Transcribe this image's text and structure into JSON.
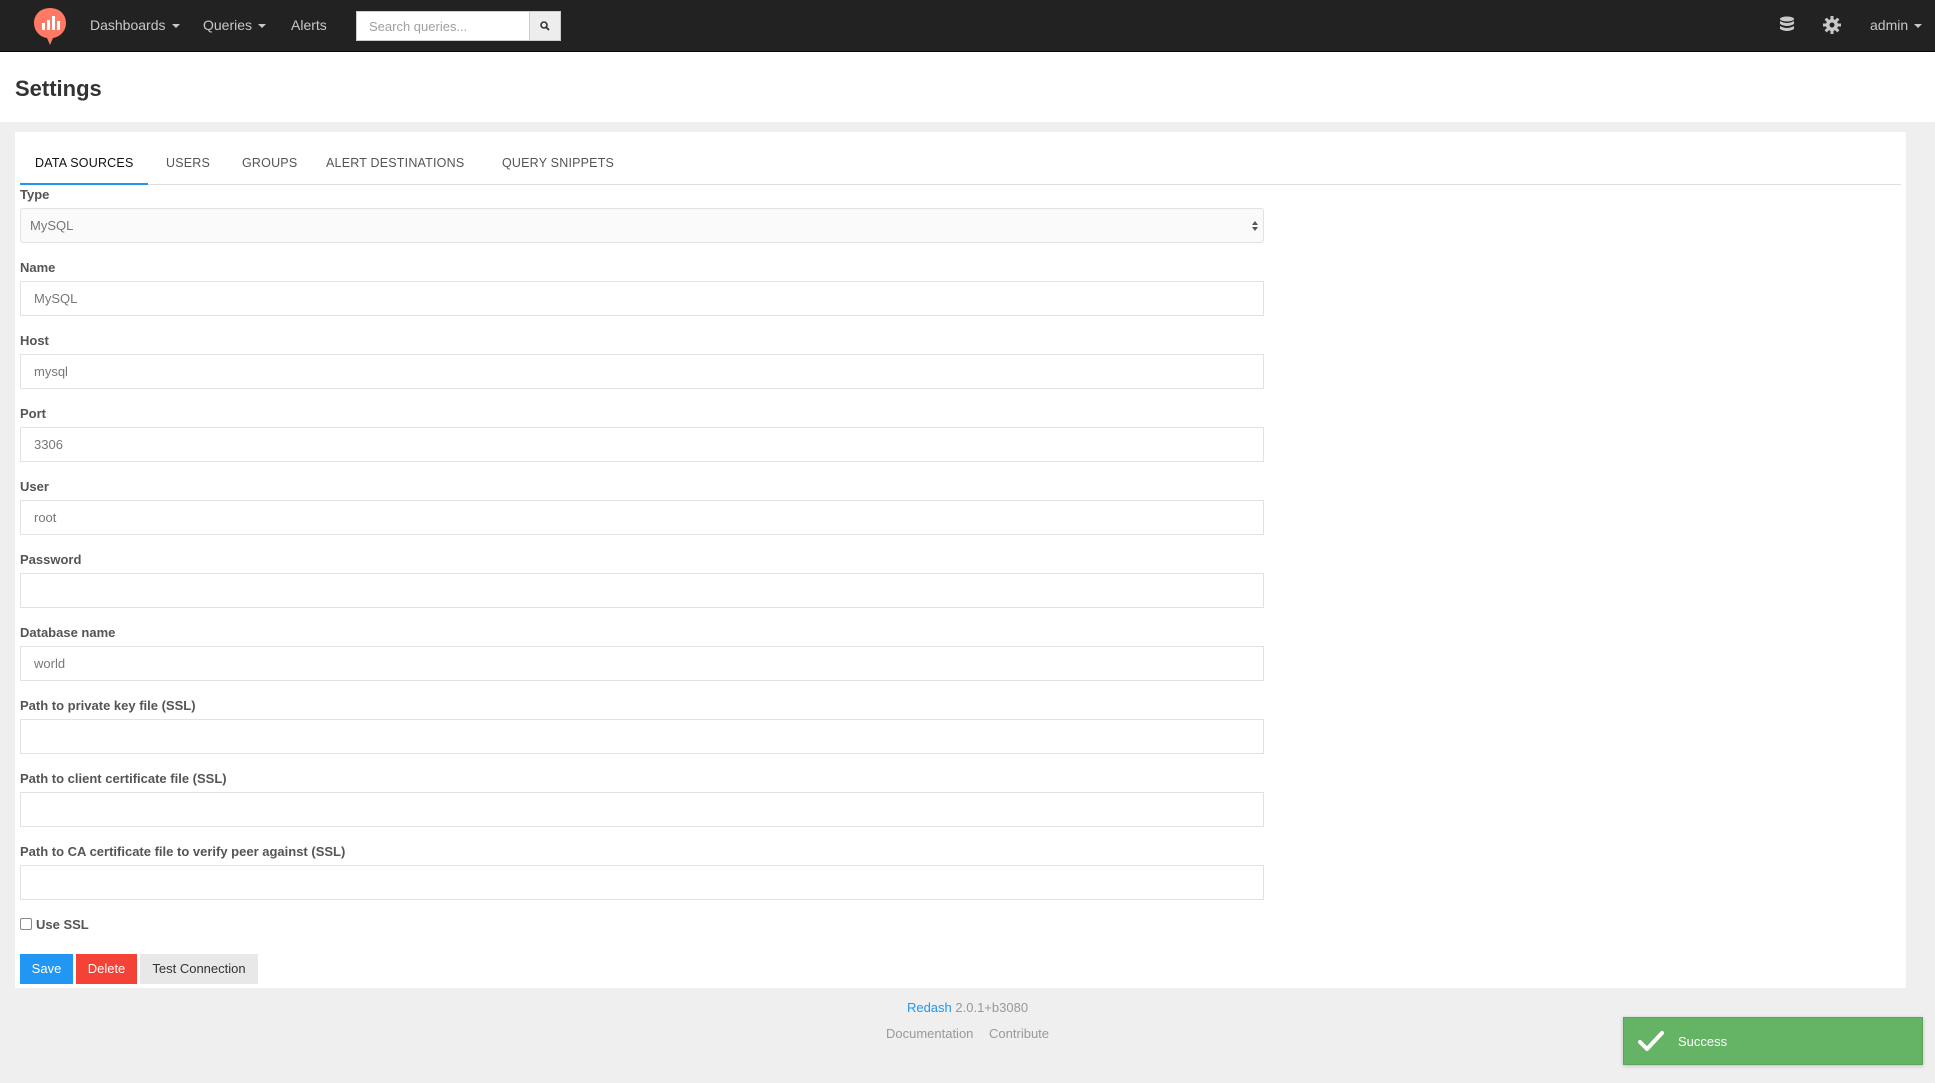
{
  "navbar": {
    "dashboards_label": "Dashboards",
    "queries_label": "Queries",
    "alerts_label": "Alerts",
    "search_placeholder": "Search queries...",
    "user_label": "admin"
  },
  "page": {
    "title": "Settings"
  },
  "tabs": [
    {
      "label": "DATA SOURCES",
      "active": true
    },
    {
      "label": "USERS"
    },
    {
      "label": "GROUPS"
    },
    {
      "label": "ALERT DESTINATIONS"
    },
    {
      "label": "QUERY SNIPPETS"
    }
  ],
  "form": {
    "type_label": "Type",
    "type_value": "MySQL",
    "fields": [
      {
        "label": "Name",
        "value": "MySQL"
      },
      {
        "label": "Host",
        "value": "mysql"
      },
      {
        "label": "Port",
        "value": "3306"
      },
      {
        "label": "User",
        "value": "root"
      },
      {
        "label": "Password",
        "value": ""
      },
      {
        "label": "Database name",
        "value": "world"
      },
      {
        "label": "Path to private key file (SSL)",
        "value": ""
      },
      {
        "label": "Path to client certificate file (SSL)",
        "value": ""
      },
      {
        "label": "Path to CA certificate file to verify peer against (SSL)",
        "value": ""
      }
    ],
    "use_ssl_label": "Use SSL",
    "use_ssl_checked": false,
    "save_label": "Save",
    "delete_label": "Delete",
    "test_label": "Test Connection"
  },
  "footer": {
    "brand": "Redash",
    "version": "2.0.1+b3080",
    "documentation": "Documentation",
    "contribute": "Contribute"
  },
  "toast": {
    "message": "Success"
  },
  "colors": {
    "navbar_bg": "#222222",
    "accent": "#2196f3",
    "danger": "#f44336",
    "success": "#65b365",
    "logo": "#ff7964"
  }
}
